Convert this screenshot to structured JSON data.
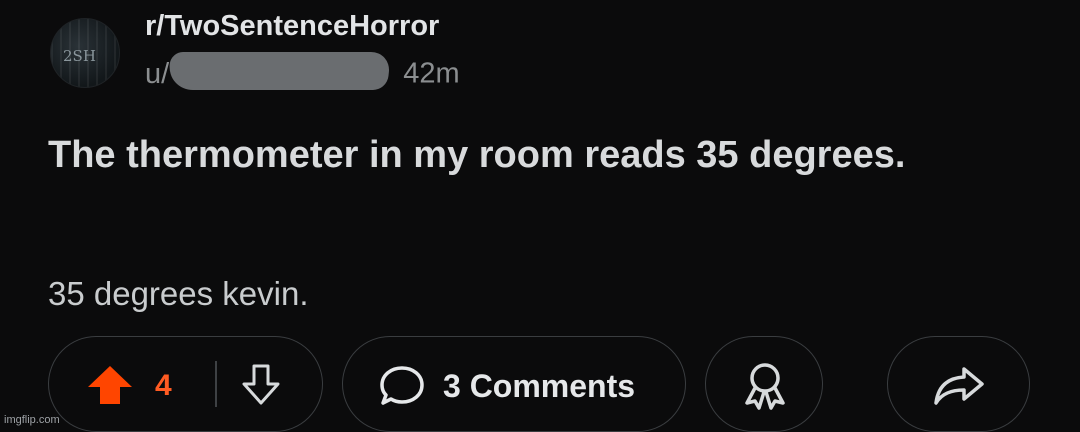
{
  "post": {
    "subreddit": "r/TwoSentenceHorror",
    "avatar_text": "2SH",
    "user_prefix": "u/",
    "time": "42m",
    "title": "The thermometer in my room reads 35 degrees.",
    "body": "35 degrees kevin."
  },
  "actions": {
    "upvote_count": "4",
    "comments_label": "3 Comments",
    "upvote_color": "#ff4500"
  },
  "watermark": "imgflip.com",
  "icons": {
    "upvote": "arrow-up-icon",
    "downvote": "arrow-down-icon",
    "comment": "comment-bubble-icon",
    "award": "award-ribbon-icon",
    "share": "share-arrow-icon"
  }
}
